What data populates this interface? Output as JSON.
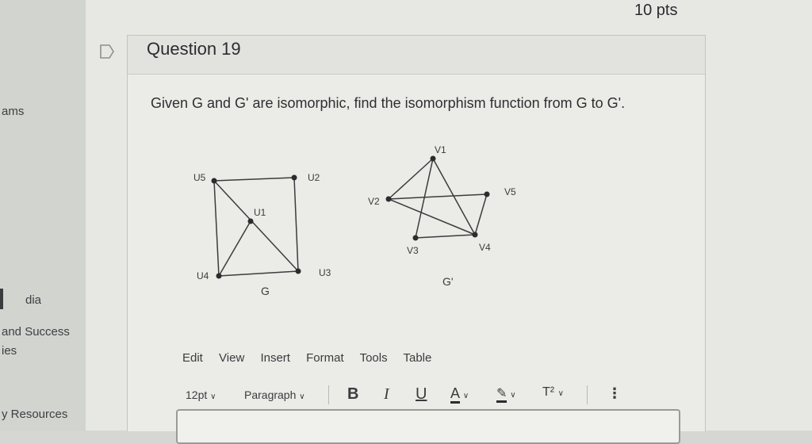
{
  "sidebar": {
    "items": [
      "ams",
      "dia",
      "and Success",
      "ies",
      "y Resources"
    ]
  },
  "question": {
    "title": "Question 19",
    "points": "10 pts",
    "text": "Given G and G' are isomorphic, find the isomorphism function from G to G'."
  },
  "graph_g": {
    "name": "G",
    "vertices": [
      "u1",
      "u2",
      "u3",
      "u4",
      "u5"
    ],
    "vertex_labels": [
      "U1",
      "U2",
      "U3",
      "U4",
      "U5"
    ],
    "edges": [
      [
        "u5",
        "u2"
      ],
      [
        "u2",
        "u3"
      ],
      [
        "u5",
        "u4"
      ],
      [
        "u4",
        "u3"
      ],
      [
        "u5",
        "u3"
      ],
      [
        "u1",
        "u4"
      ]
    ]
  },
  "graph_gp": {
    "name": "G'",
    "vertices": [
      "v1",
      "v2",
      "v3",
      "v4",
      "v5"
    ],
    "vertex_labels": [
      "V1",
      "V2",
      "V3",
      "V4",
      "V5"
    ],
    "edges": [
      [
        "v1",
        "v2"
      ],
      [
        "v1",
        "v3"
      ],
      [
        "v1",
        "v4"
      ],
      [
        "v2",
        "v5"
      ],
      [
        "v5",
        "v4"
      ],
      [
        "v3",
        "v4"
      ],
      [
        "v2",
        "v4"
      ]
    ]
  },
  "editor": {
    "menu": [
      "Edit",
      "View",
      "Insert",
      "Format",
      "Tools",
      "Table"
    ],
    "font_size": "12pt",
    "block_format": "Paragraph",
    "bold": "B",
    "italic": "I",
    "underline": "U",
    "text_color": "A",
    "superscript": "T²",
    "more": "⋮"
  }
}
